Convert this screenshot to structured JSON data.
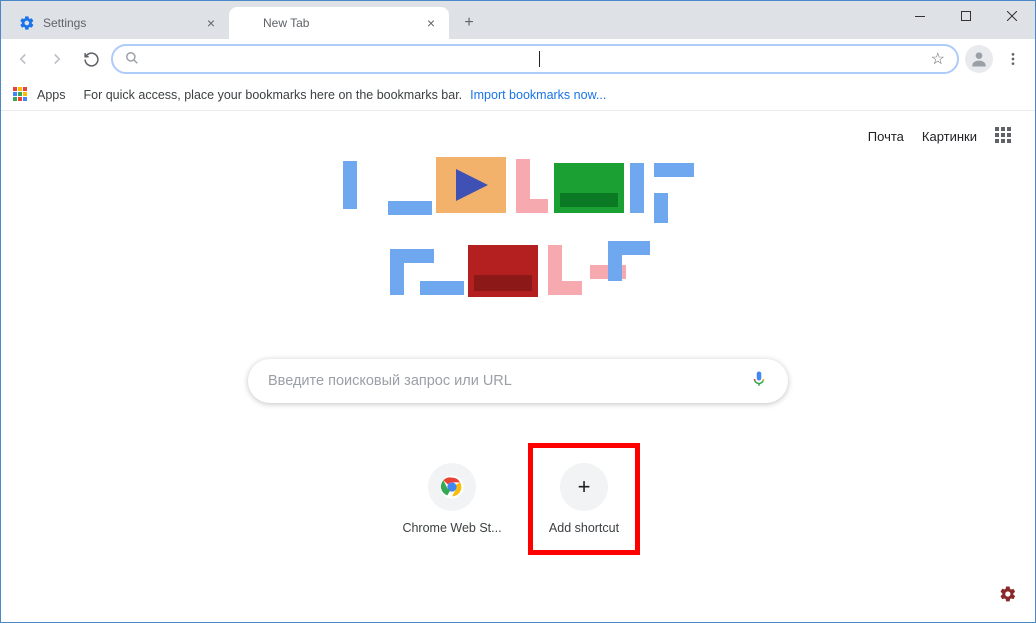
{
  "window": {
    "tabs": [
      {
        "title": "Settings",
        "active": false
      },
      {
        "title": "New Tab",
        "active": true
      }
    ]
  },
  "toolbar": {
    "omnibox_value": ""
  },
  "bookmark_bar": {
    "apps_label": "Apps",
    "hint_text": "For quick access, place your bookmarks here on the bookmarks bar.",
    "import_link": "Import bookmarks now..."
  },
  "ntp": {
    "top_links": {
      "mail": "Почта",
      "images": "Картинки"
    },
    "search_placeholder": "Введите поисковый запрос или URL",
    "shortcuts": [
      {
        "label": "Chrome Web St...",
        "kind": "webstore"
      },
      {
        "label": "Add shortcut",
        "kind": "add",
        "highlighted": true
      }
    ]
  }
}
